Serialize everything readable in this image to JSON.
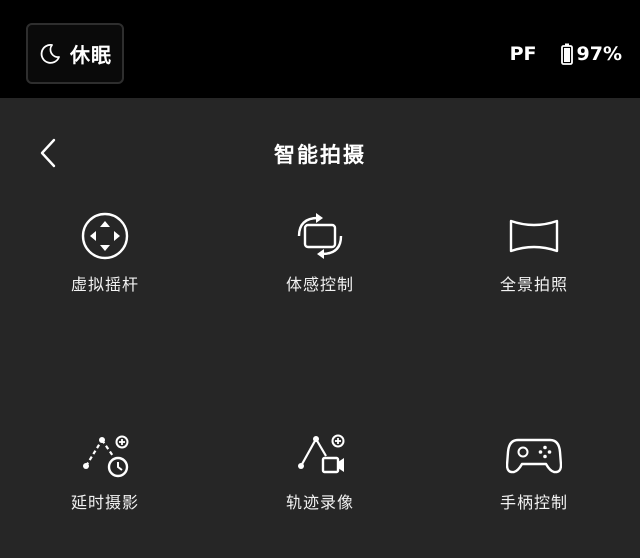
{
  "status_bar": {
    "sleep_label": "休眠",
    "sleep_icon": "moon-icon",
    "flight_mode": "PF",
    "battery_percent": "97%",
    "battery_icon": "battery-icon"
  },
  "panel": {
    "title": "智能拍摄",
    "back_icon": "chevron-left-icon",
    "items": [
      {
        "label": "虚拟摇杆",
        "icon": "virtual-joystick-icon"
      },
      {
        "label": "体感控制",
        "icon": "motion-control-icon"
      },
      {
        "label": "全景拍照",
        "icon": "panorama-icon"
      },
      {
        "label": "延时摄影",
        "icon": "timelapse-icon"
      },
      {
        "label": "轨迹录像",
        "icon": "trajectory-video-icon"
      },
      {
        "label": "手柄控制",
        "icon": "gamepad-icon"
      }
    ]
  },
  "colors": {
    "top_bar_bg": "#000000",
    "panel_bg": "#262626",
    "text": "#ffffff"
  }
}
